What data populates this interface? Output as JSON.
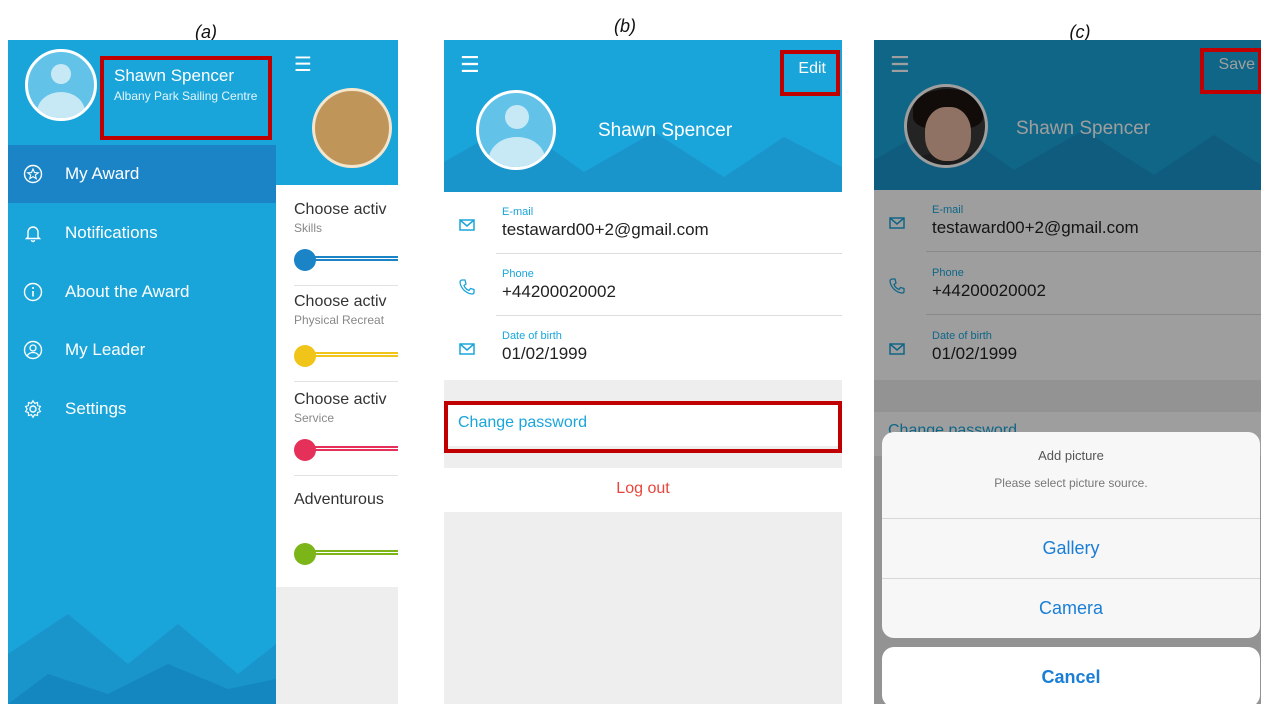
{
  "captions": {
    "a": "(a)",
    "b": "(b)",
    "c": "(c)"
  },
  "panel_a": {
    "user_name": "Shawn Spencer",
    "user_org": "Albany Park Sailing Centre",
    "menu": [
      {
        "label": "My Award",
        "icon": "star-circle-icon"
      },
      {
        "label": "Notifications",
        "icon": "bell-icon"
      },
      {
        "label": "About the Award",
        "icon": "info-icon"
      },
      {
        "label": "My Leader",
        "icon": "user-circle-icon"
      },
      {
        "label": "Settings",
        "icon": "gear-icon"
      }
    ],
    "activities": [
      {
        "title": "Choose activ",
        "subtitle": "Skills",
        "color": "#1a84c7"
      },
      {
        "title": "Choose activ",
        "subtitle": "Physical Recreat",
        "color": "#f0c419"
      },
      {
        "title": "Choose activ",
        "subtitle": "Service",
        "color": "#e5305a"
      },
      {
        "title": "Adventurous",
        "subtitle": "",
        "color": "#7cb518"
      }
    ]
  },
  "panel_b": {
    "edit_label": "Edit",
    "name": "Shawn Spencer",
    "fields": [
      {
        "label": "E-mail",
        "value": "testaward00+2@gmail.com"
      },
      {
        "label": "Phone",
        "value": "+44200020002"
      },
      {
        "label": "Date of birth",
        "value": "01/02/1999"
      }
    ],
    "change_password": "Change password",
    "log_out": "Log out"
  },
  "panel_c": {
    "save_label": "Save",
    "name": "Shawn Spencer",
    "fields": [
      {
        "label": "E-mail",
        "value": "testaward00+2@gmail.com"
      },
      {
        "label": "Phone",
        "value": "+44200020002"
      },
      {
        "label": "Date of birth",
        "value": "01/02/1999"
      }
    ],
    "change_password": "Change password",
    "sheet": {
      "title": "Add picture",
      "subtitle": "Please select picture source.",
      "gallery": "Gallery",
      "camera": "Camera",
      "cancel": "Cancel"
    }
  },
  "colors": {
    "brand_blue": "#1aa5da",
    "active_blue": "#1a84c7",
    "highlight_red": "#c00000",
    "logout_red": "#e8453c",
    "ios_blue": "#1a7ed6"
  }
}
